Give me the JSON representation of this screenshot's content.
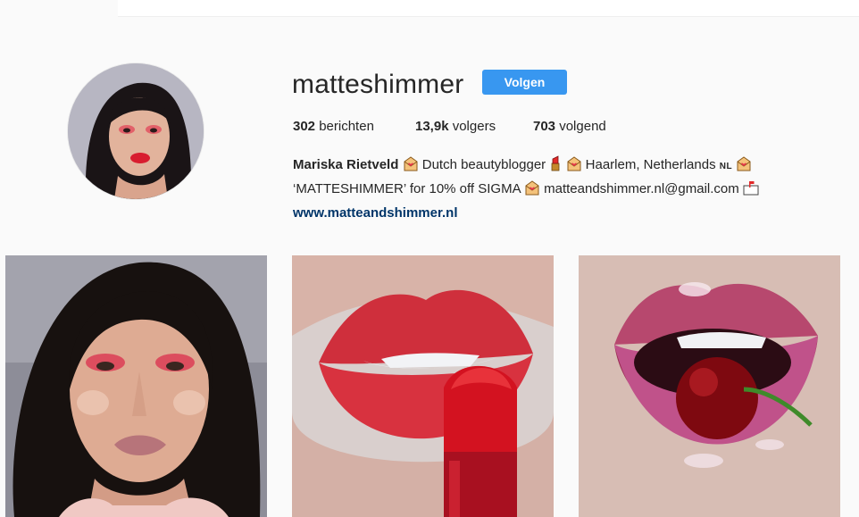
{
  "profile": {
    "username": "matteshimmer",
    "follow_label": "Volgen",
    "stats": {
      "posts_count": "302",
      "posts_label": "berichten",
      "followers_count": "13,9k",
      "followers_label": "volgers",
      "following_count": "703",
      "following_label": "volgend"
    },
    "bio": {
      "name": "Mariska Rietveld",
      "line1_a": " Dutch beautyblogger ",
      "line1_b": " Haarlem, Netherlands ",
      "nl": "NL",
      "line2_a": "‘MATTESHIMMER’ for 10% off SIGMA ",
      "line2_b": " matteandshimmer.nl@gmail.com ",
      "website": "www.matteandshimmer.nl"
    }
  },
  "posts": [
    {
      "subject": "portrait-photo"
    },
    {
      "subject": "red-lipstick-photo"
    },
    {
      "subject": "cherry-lips-photo"
    }
  ],
  "colors": {
    "follow_button": "#3897f0",
    "link": "#003569",
    "background": "#fafafa"
  }
}
